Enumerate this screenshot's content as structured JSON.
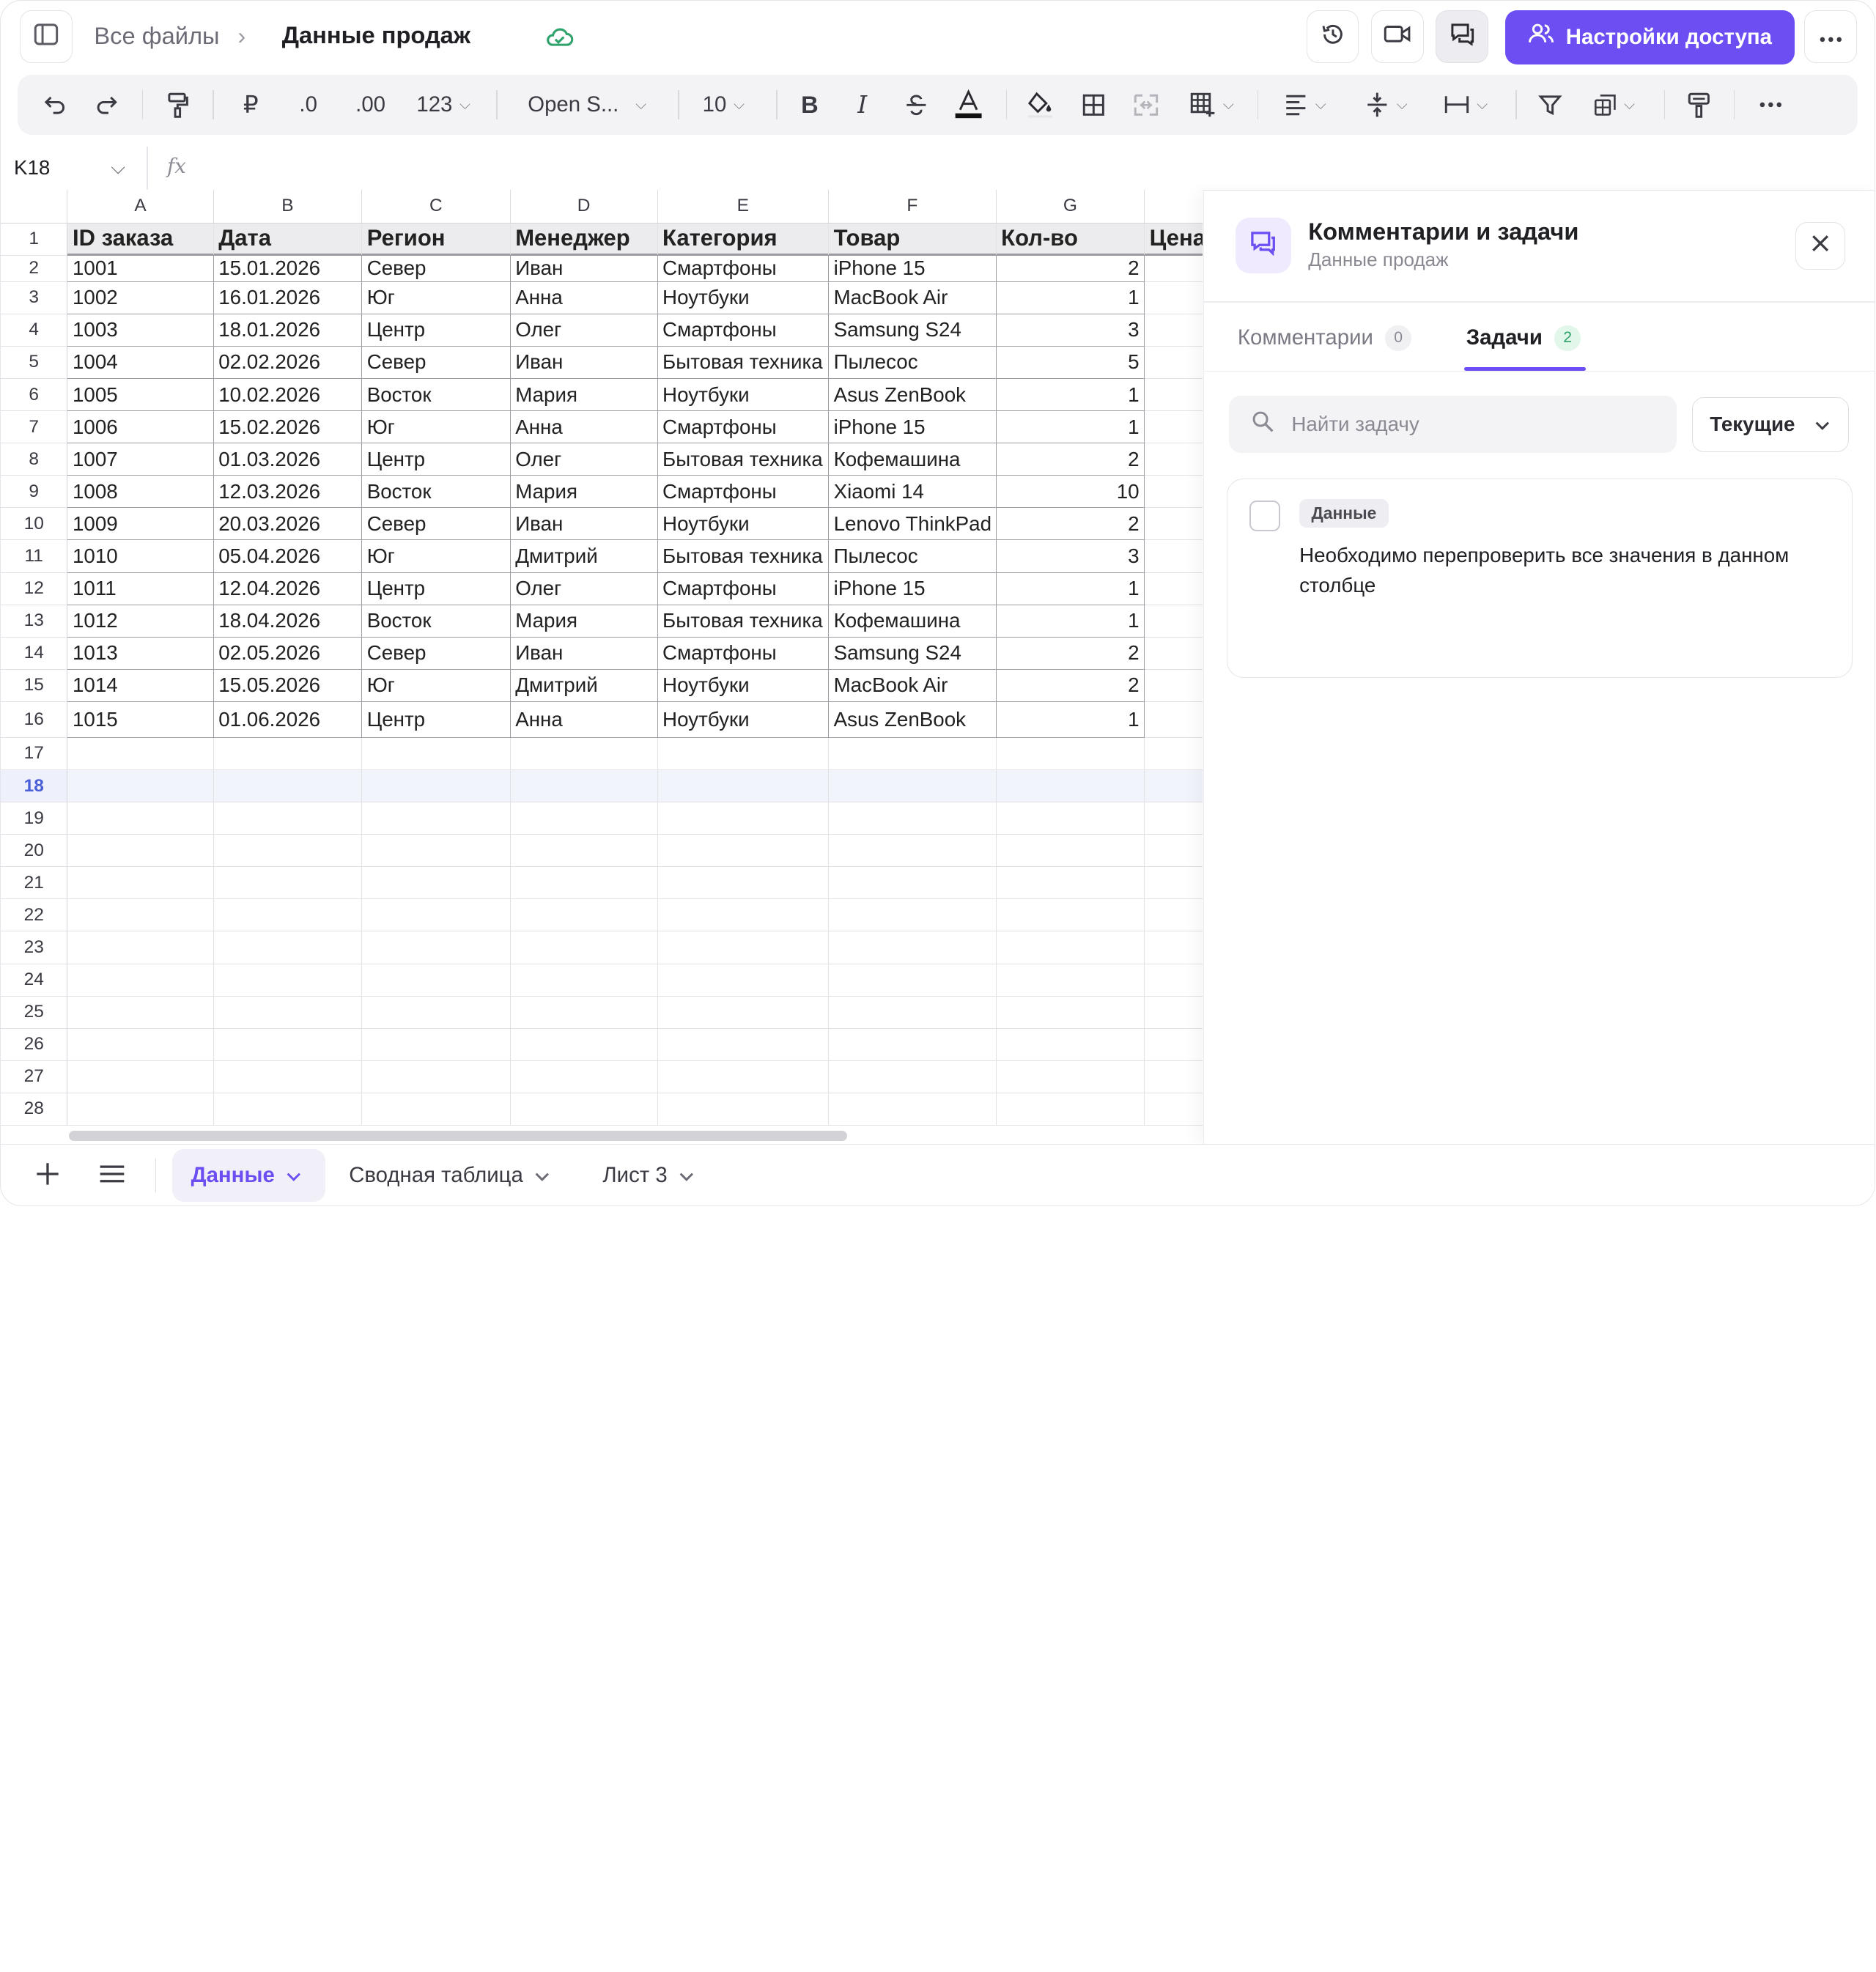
{
  "breadcrumb": {
    "root": "Все файлы",
    "separator": "›",
    "document": "Данные продаж"
  },
  "header": {
    "share_button": "Настройки доступа",
    "accent_color": "#6c4ef2"
  },
  "toolbar": {
    "currency": "₽",
    "decimal_decrease": ".0",
    "decimal_increase": ".00",
    "number_format": "123",
    "font_family": "Open S...",
    "font_size": "10",
    "bold": "B",
    "italic": "I"
  },
  "formula_bar": {
    "cell_ref": "K18",
    "fx": "fx",
    "value": ""
  },
  "sheet": {
    "columns": [
      "A",
      "B",
      "C",
      "D",
      "E",
      "F",
      "G"
    ],
    "headers": [
      "ID заказа",
      "Дата",
      "Регион",
      "Менеджер",
      "Категория",
      "Товар",
      "Кол-во",
      "Цена"
    ],
    "rows": [
      [
        "1001",
        "15.01.2026",
        "Север",
        "Иван",
        "Смартфоны",
        "iPhone 15",
        "2"
      ],
      [
        "1002",
        "16.01.2026",
        "Юг",
        "Анна",
        "Ноутбуки",
        "MacBook Air",
        "1"
      ],
      [
        "1003",
        "18.01.2026",
        "Центр",
        "Олег",
        "Смартфоны",
        "Samsung S24",
        "3"
      ],
      [
        "1004",
        "02.02.2026",
        "Север",
        "Иван",
        "Бытовая техника",
        "Пылесос",
        "5"
      ],
      [
        "1005",
        "10.02.2026",
        "Восток",
        "Мария",
        "Ноутбуки",
        "Asus ZenBook",
        "1"
      ],
      [
        "1006",
        "15.02.2026",
        "Юг",
        "Анна",
        "Смартфоны",
        "iPhone 15",
        "1"
      ],
      [
        "1007",
        "01.03.2026",
        "Центр",
        "Олег",
        "Бытовая техника",
        "Кофемашина",
        "2"
      ],
      [
        "1008",
        "12.03.2026",
        "Восток",
        "Мария",
        "Смартфоны",
        "Xiaomi 14",
        "10"
      ],
      [
        "1009",
        "20.03.2026",
        "Север",
        "Иван",
        "Ноутбуки",
        "Lenovo ThinkPad",
        "2"
      ],
      [
        "1010",
        "05.04.2026",
        "Юг",
        "Дмитрий",
        "Бытовая техника",
        "Пылесос",
        "3"
      ],
      [
        "1011",
        "12.04.2026",
        "Центр",
        "Олег",
        "Смартфоны",
        "iPhone 15",
        "1"
      ],
      [
        "1012",
        "18.04.2026",
        "Восток",
        "Мария",
        "Бытовая техника",
        "Кофемашина",
        "1"
      ],
      [
        "1013",
        "02.05.2026",
        "Север",
        "Иван",
        "Смартфоны",
        "Samsung S24",
        "2"
      ],
      [
        "1014",
        "15.05.2026",
        "Юг",
        "Дмитрий",
        "Ноутбуки",
        "MacBook Air",
        "2"
      ],
      [
        "1015",
        "01.06.2026",
        "Центр",
        "Анна",
        "Ноутбуки",
        "Asus ZenBook",
        "1"
      ]
    ],
    "row_numbers": [
      "1",
      "2",
      "3",
      "4",
      "5",
      "6",
      "7",
      "8",
      "9",
      "10",
      "11",
      "12",
      "13",
      "14",
      "15",
      "16",
      "17",
      "18",
      "19",
      "20",
      "21",
      "22",
      "23",
      "24",
      "25",
      "26",
      "27",
      "28"
    ],
    "selected_row": "18"
  },
  "panel": {
    "title": "Комментарии и задачи",
    "subtitle": "Данные продаж",
    "tabs": [
      {
        "label": "Комментарии",
        "count": "0"
      },
      {
        "label": "Задачи",
        "count": "2"
      }
    ],
    "search_placeholder": "Найти задачу",
    "filter": "Текущие",
    "task": {
      "tag": "Данные",
      "text": "Необходимо перепроверить все значения в данном столбце"
    }
  },
  "sheets_bar": {
    "tabs": [
      {
        "label": "Данные"
      },
      {
        "label": "Сводная таблица"
      },
      {
        "label": "Лист 3"
      }
    ]
  }
}
